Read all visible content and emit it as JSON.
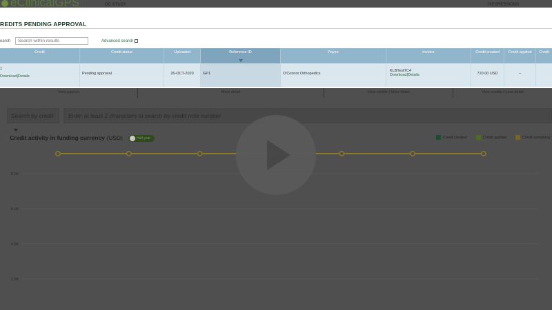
{
  "header": {
    "logo": "eClinicalGPS",
    "study": "OC STUDY",
    "user": "REGRESSIONS"
  },
  "panel": {
    "title": "REDITS PENDING APPROVAL",
    "search_label": "earch",
    "search_placeholder": "Search within results",
    "advanced_search": "Advanced search",
    "columns": [
      "Credit",
      "Credit status",
      "Uploaded",
      "Reference ID",
      "Payee",
      "Invoice",
      "Credit created",
      "Credit applied",
      "Credit"
    ],
    "row": {
      "credit_id": "1",
      "credit_link": "Download|Details",
      "status": "Pending approval",
      "uploaded": "26-OCT-2020",
      "reference_id": "GP1",
      "payee": "O'Connor Orthopedics",
      "invoice_id": "KLBTestTC4",
      "invoice_link": "Download|Details",
      "created": "720.00 USD",
      "applied": "--"
    }
  },
  "links_row": [
    "View payees",
    "More detail",
    "View credits  |  More detail",
    "View credits  |  Less detail"
  ],
  "search": {
    "by_label": "Search by credit",
    "placeholder": "Enter at least 2 characters to search by credit note number"
  },
  "chart_title": "Credit activity in funding currency",
  "chart_currency": "(USD)",
  "toggle_label": "Half year",
  "legend": [
    {
      "label": "Credit created",
      "color": "#1f5a3c"
    },
    {
      "label": "Credit applied",
      "color": "#6d8f3c"
    },
    {
      "label": "Credit remaining",
      "color": "#a88a1c"
    }
  ],
  "chart_data": {
    "type": "line",
    "y_ticks": [
      "8.0K",
      "6.0K",
      "4.0K",
      "2.0K"
    ],
    "series": [
      {
        "name": "Credit remaining",
        "color": "#8a7a2a",
        "values": [
          10,
          10,
          10,
          10,
          10,
          10,
          10
        ]
      }
    ],
    "ylim": [
      0,
      10
    ]
  }
}
